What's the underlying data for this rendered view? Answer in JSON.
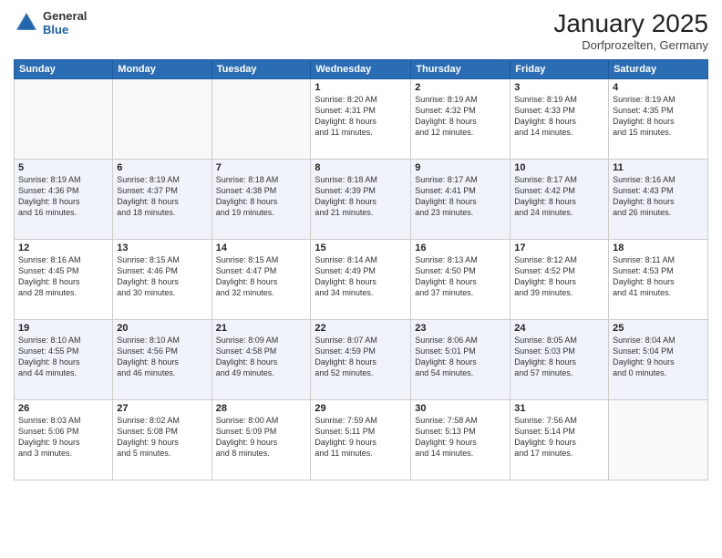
{
  "header": {
    "logo_general": "General",
    "logo_blue": "Blue",
    "month_title": "January 2025",
    "location": "Dorfprozelten, Germany"
  },
  "days_of_week": [
    "Sunday",
    "Monday",
    "Tuesday",
    "Wednesday",
    "Thursday",
    "Friday",
    "Saturday"
  ],
  "weeks": [
    [
      {
        "day": "",
        "info": ""
      },
      {
        "day": "",
        "info": ""
      },
      {
        "day": "",
        "info": ""
      },
      {
        "day": "1",
        "info": "Sunrise: 8:20 AM\nSunset: 4:31 PM\nDaylight: 8 hours\nand 11 minutes."
      },
      {
        "day": "2",
        "info": "Sunrise: 8:19 AM\nSunset: 4:32 PM\nDaylight: 8 hours\nand 12 minutes."
      },
      {
        "day": "3",
        "info": "Sunrise: 8:19 AM\nSunset: 4:33 PM\nDaylight: 8 hours\nand 14 minutes."
      },
      {
        "day": "4",
        "info": "Sunrise: 8:19 AM\nSunset: 4:35 PM\nDaylight: 8 hours\nand 15 minutes."
      }
    ],
    [
      {
        "day": "5",
        "info": "Sunrise: 8:19 AM\nSunset: 4:36 PM\nDaylight: 8 hours\nand 16 minutes."
      },
      {
        "day": "6",
        "info": "Sunrise: 8:19 AM\nSunset: 4:37 PM\nDaylight: 8 hours\nand 18 minutes."
      },
      {
        "day": "7",
        "info": "Sunrise: 8:18 AM\nSunset: 4:38 PM\nDaylight: 8 hours\nand 19 minutes."
      },
      {
        "day": "8",
        "info": "Sunrise: 8:18 AM\nSunset: 4:39 PM\nDaylight: 8 hours\nand 21 minutes."
      },
      {
        "day": "9",
        "info": "Sunrise: 8:17 AM\nSunset: 4:41 PM\nDaylight: 8 hours\nand 23 minutes."
      },
      {
        "day": "10",
        "info": "Sunrise: 8:17 AM\nSunset: 4:42 PM\nDaylight: 8 hours\nand 24 minutes."
      },
      {
        "day": "11",
        "info": "Sunrise: 8:16 AM\nSunset: 4:43 PM\nDaylight: 8 hours\nand 26 minutes."
      }
    ],
    [
      {
        "day": "12",
        "info": "Sunrise: 8:16 AM\nSunset: 4:45 PM\nDaylight: 8 hours\nand 28 minutes."
      },
      {
        "day": "13",
        "info": "Sunrise: 8:15 AM\nSunset: 4:46 PM\nDaylight: 8 hours\nand 30 minutes."
      },
      {
        "day": "14",
        "info": "Sunrise: 8:15 AM\nSunset: 4:47 PM\nDaylight: 8 hours\nand 32 minutes."
      },
      {
        "day": "15",
        "info": "Sunrise: 8:14 AM\nSunset: 4:49 PM\nDaylight: 8 hours\nand 34 minutes."
      },
      {
        "day": "16",
        "info": "Sunrise: 8:13 AM\nSunset: 4:50 PM\nDaylight: 8 hours\nand 37 minutes."
      },
      {
        "day": "17",
        "info": "Sunrise: 8:12 AM\nSunset: 4:52 PM\nDaylight: 8 hours\nand 39 minutes."
      },
      {
        "day": "18",
        "info": "Sunrise: 8:11 AM\nSunset: 4:53 PM\nDaylight: 8 hours\nand 41 minutes."
      }
    ],
    [
      {
        "day": "19",
        "info": "Sunrise: 8:10 AM\nSunset: 4:55 PM\nDaylight: 8 hours\nand 44 minutes."
      },
      {
        "day": "20",
        "info": "Sunrise: 8:10 AM\nSunset: 4:56 PM\nDaylight: 8 hours\nand 46 minutes."
      },
      {
        "day": "21",
        "info": "Sunrise: 8:09 AM\nSunset: 4:58 PM\nDaylight: 8 hours\nand 49 minutes."
      },
      {
        "day": "22",
        "info": "Sunrise: 8:07 AM\nSunset: 4:59 PM\nDaylight: 8 hours\nand 52 minutes."
      },
      {
        "day": "23",
        "info": "Sunrise: 8:06 AM\nSunset: 5:01 PM\nDaylight: 8 hours\nand 54 minutes."
      },
      {
        "day": "24",
        "info": "Sunrise: 8:05 AM\nSunset: 5:03 PM\nDaylight: 8 hours\nand 57 minutes."
      },
      {
        "day": "25",
        "info": "Sunrise: 8:04 AM\nSunset: 5:04 PM\nDaylight: 9 hours\nand 0 minutes."
      }
    ],
    [
      {
        "day": "26",
        "info": "Sunrise: 8:03 AM\nSunset: 5:06 PM\nDaylight: 9 hours\nand 3 minutes."
      },
      {
        "day": "27",
        "info": "Sunrise: 8:02 AM\nSunset: 5:08 PM\nDaylight: 9 hours\nand 5 minutes."
      },
      {
        "day": "28",
        "info": "Sunrise: 8:00 AM\nSunset: 5:09 PM\nDaylight: 9 hours\nand 8 minutes."
      },
      {
        "day": "29",
        "info": "Sunrise: 7:59 AM\nSunset: 5:11 PM\nDaylight: 9 hours\nand 11 minutes."
      },
      {
        "day": "30",
        "info": "Sunrise: 7:58 AM\nSunset: 5:13 PM\nDaylight: 9 hours\nand 14 minutes."
      },
      {
        "day": "31",
        "info": "Sunrise: 7:56 AM\nSunset: 5:14 PM\nDaylight: 9 hours\nand 17 minutes."
      },
      {
        "day": "",
        "info": ""
      }
    ]
  ]
}
